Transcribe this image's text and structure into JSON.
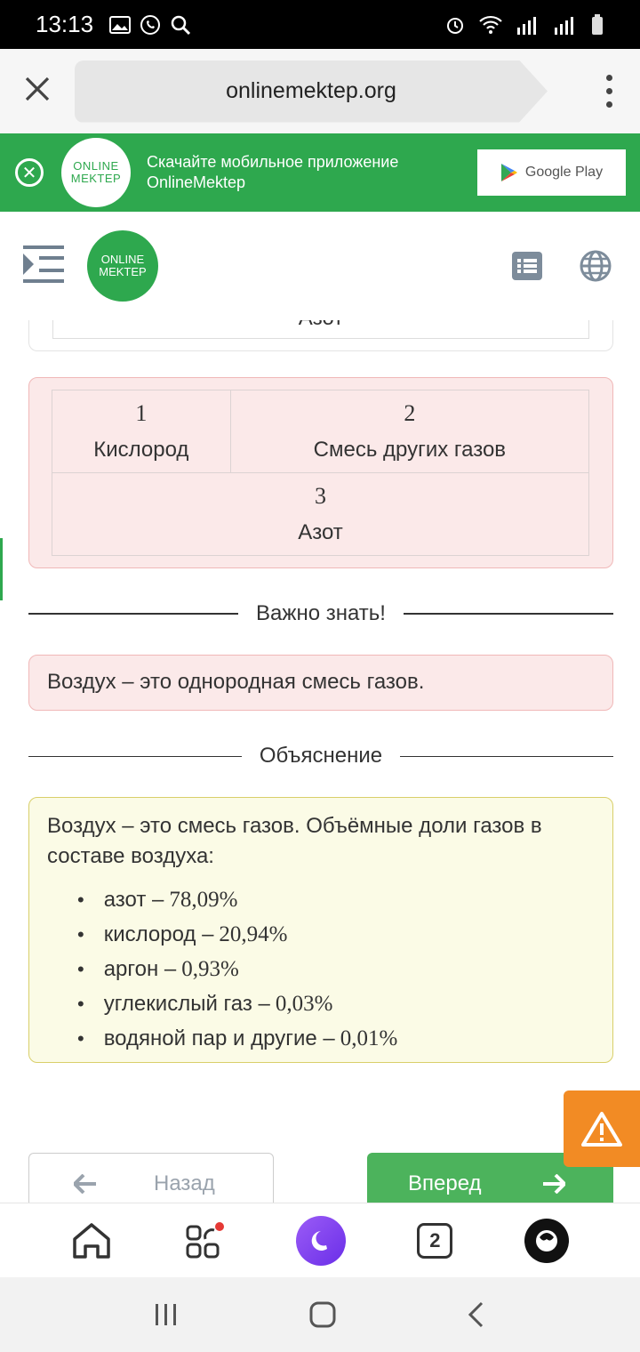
{
  "status_bar": {
    "time": "13:13"
  },
  "browser": {
    "url": "onlinemektep.org",
    "tab_count": "2"
  },
  "banner": {
    "logo_line1": "ONLINE",
    "logo_line2": "MEKTEP",
    "text_line1": "Скачайте мобильное приложение",
    "text_line2": "OnlineMektep",
    "store_label": "Google Play"
  },
  "header": {
    "logo_line1": "ONLINE",
    "logo_line2": "MEKTEP"
  },
  "top_card": {
    "cell": "Азот"
  },
  "answer_table": {
    "cells": [
      {
        "num": "1",
        "label": "Кислород"
      },
      {
        "num": "2",
        "label": "Смесь других газов"
      },
      {
        "num": "3",
        "label": "Азот"
      }
    ]
  },
  "important": {
    "heading": "Важно знать!",
    "text": "Воздух – это однородная смесь газов."
  },
  "explanation": {
    "heading": "Объяснение",
    "intro": "Воздух – это смесь газов. Объёмные доли газов в составе воздуха:",
    "items": [
      {
        "label": "азот –",
        "value": "78,09%"
      },
      {
        "label": "кислород –",
        "value": "20,94%"
      },
      {
        "label": "аргон –",
        "value": "0,93%"
      },
      {
        "label": "углекислый газ –",
        "value": "0,03%"
      },
      {
        "label": "водяной пар и другие –",
        "value": "0,01%"
      }
    ]
  },
  "nav": {
    "back_label": "Назад",
    "next_label": "Вперед"
  },
  "colors": {
    "brand_green": "#2ea84e",
    "error_bg": "#fbe9e9",
    "explain_bg": "#fbfbe6",
    "warn_orange": "#f28b24"
  }
}
